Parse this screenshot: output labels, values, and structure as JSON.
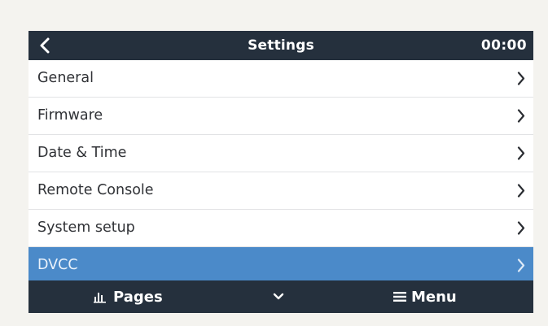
{
  "header": {
    "title": "Settings",
    "clock": "00:00",
    "back_icon": "chevron-left-icon"
  },
  "menu": {
    "items": [
      {
        "label": "General",
        "icon": "chevron-right-icon",
        "selected": false
      },
      {
        "label": "Firmware",
        "icon": "chevron-right-icon",
        "selected": false
      },
      {
        "label": "Date & Time",
        "icon": "chevron-right-icon",
        "selected": false
      },
      {
        "label": "Remote Console",
        "icon": "chevron-right-icon",
        "selected": false
      },
      {
        "label": "System setup",
        "icon": "chevron-right-icon",
        "selected": false
      },
      {
        "label": "DVCC",
        "icon": "chevron-right-icon",
        "selected": true
      }
    ]
  },
  "footer": {
    "pages_label": "Pages",
    "pages_icon": "bar-chart-icon",
    "down_icon": "chevron-down-icon",
    "menu_label": "Menu",
    "menu_icon": "hamburger-icon"
  },
  "colors": {
    "bar_background": "#25303d",
    "selected_row": "#4b8ac9",
    "row_text": "#303236",
    "divider": "#e2e3e5"
  }
}
